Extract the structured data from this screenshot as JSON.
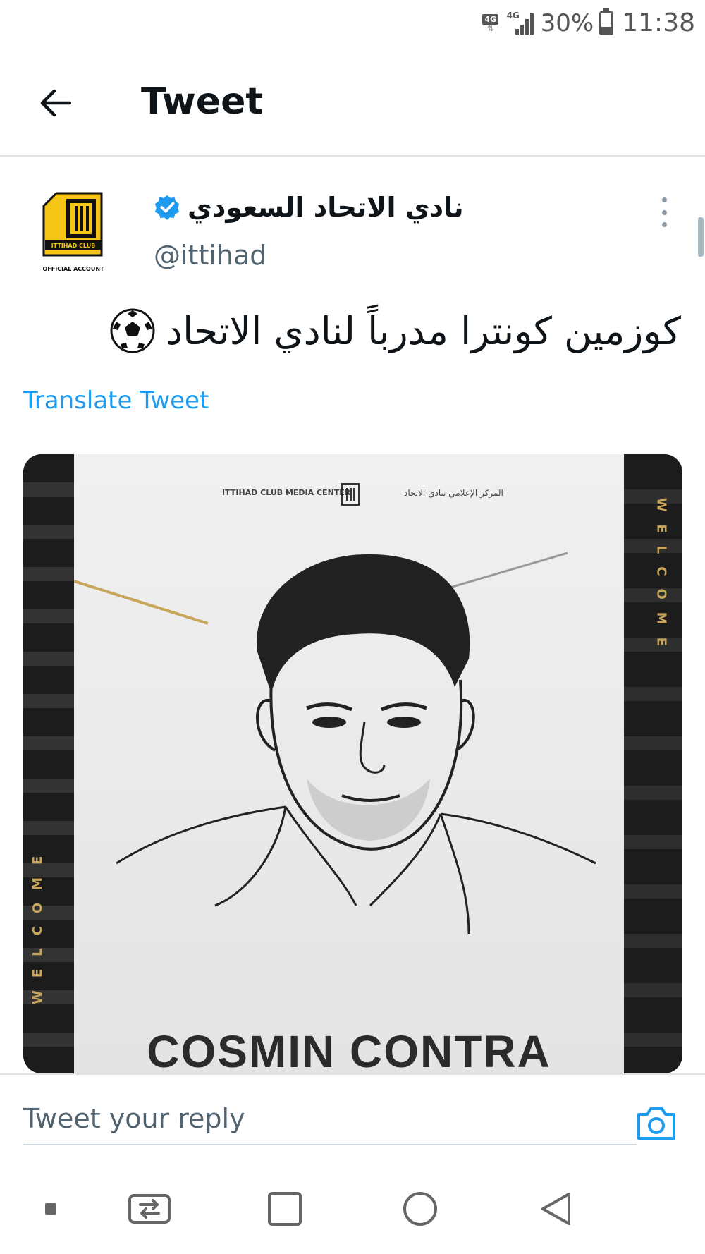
{
  "status_bar": {
    "network_badge": "4G",
    "signal_label": "4G",
    "battery_percent": "30%",
    "battery_level": 0.3,
    "time": "11:38"
  },
  "header": {
    "title": "Tweet"
  },
  "tweet": {
    "author_name": "نادي الاتحاد السعودي",
    "author_handle": "@ittihad",
    "verified": true,
    "avatar_text_top": "ITTIHAD CLUB",
    "avatar_text_bottom": "OFFICIAL ACCOUNT",
    "text": "كوزمين كونترا مدرباً لنادي الاتحاد",
    "emoji_icon": "soccer-ball-icon",
    "translate_label": "Translate Tweet",
    "media": {
      "brand_en": "ITTIHAD CLUB MEDIA CENTER",
      "brand_ar": "المركز الإعلامي بنادي الاتحاد",
      "welcome": "WELCOME",
      "coach_name": "COSMIN CONTRA"
    }
  },
  "reply": {
    "placeholder": "Tweet your reply"
  },
  "colors": {
    "accent": "#1d9bf0",
    "text": "#0f1419",
    "secondary": "#536471",
    "club_gold": "#f5c518"
  }
}
